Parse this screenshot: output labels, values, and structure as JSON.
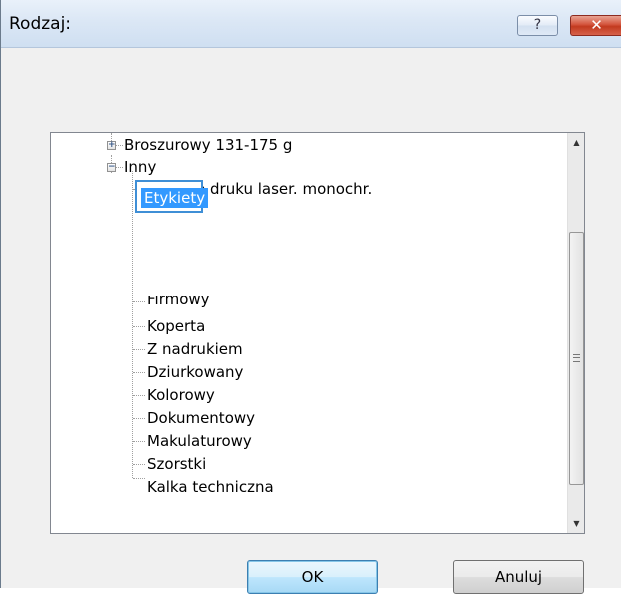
{
  "dialog": {
    "title": "Rodzaj:",
    "help_label": "?",
    "close_label": "✕"
  },
  "tree": {
    "items": [
      {
        "label": "Broszurowy 131-175 g",
        "expander": "+"
      },
      {
        "label": "Inny",
        "expander": "−"
      },
      {
        "label": "Folia do druku laser. monochr."
      },
      {
        "label": "Etykiety",
        "selected": true
      },
      {
        "label": "Firmowy"
      },
      {
        "label": "Koperta"
      },
      {
        "label": "Z nadrukiem"
      },
      {
        "label": "Dziurkowany"
      },
      {
        "label": "Kolorowy"
      },
      {
        "label": "Dokumentowy"
      },
      {
        "label": "Makulaturowy"
      },
      {
        "label": "Szorstki"
      },
      {
        "label": "Kalka techniczna"
      }
    ]
  },
  "scrollbar": {
    "up_icon": "▲",
    "down_icon": "▼"
  },
  "buttons": {
    "ok_label": "OK",
    "cancel_label": "Anuluj"
  },
  "colors": {
    "selection": "#3399ff",
    "focus_border": "#3f8fd6",
    "close_button": "#c23a1f"
  }
}
